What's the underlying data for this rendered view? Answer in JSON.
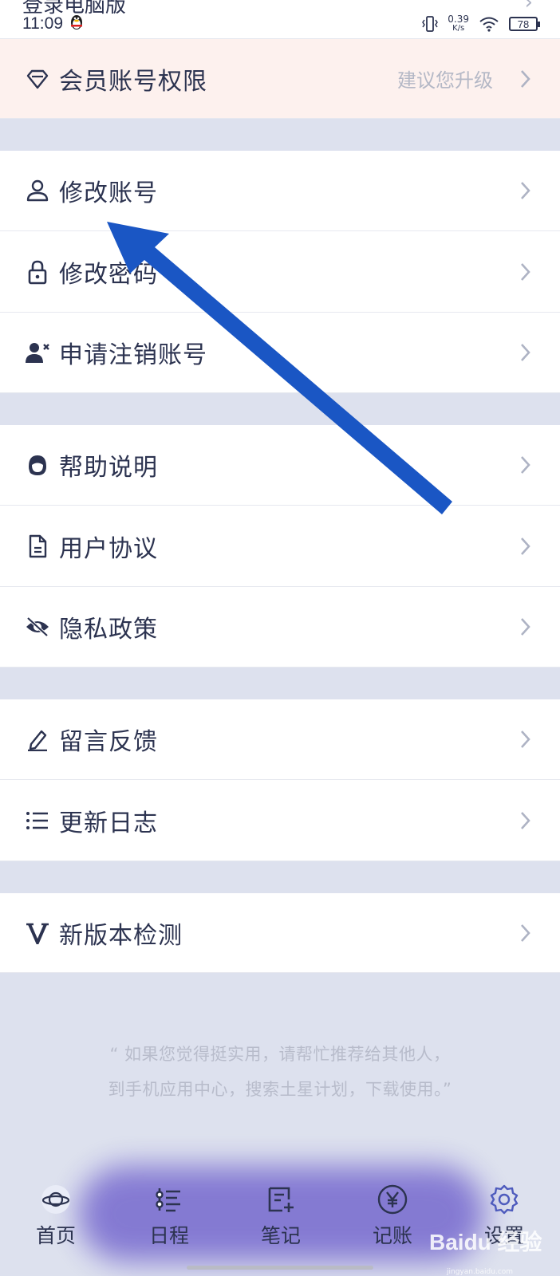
{
  "status_bar": {
    "cut_row_label": "登录电脑版",
    "time": "11:09",
    "net_speed_value": "0.39",
    "net_speed_unit": "K/s",
    "battery": "78"
  },
  "settings": {
    "member": {
      "label": "会员账号权限",
      "hint": "建议您升级",
      "icon": "diamond-icon"
    },
    "account_group": [
      {
        "label": "修改账号",
        "icon": "user-icon"
      },
      {
        "label": "修改密码",
        "icon": "lock-icon"
      },
      {
        "label": "申请注销账号",
        "icon": "user-remove-icon"
      }
    ],
    "info_group": [
      {
        "label": "帮助说明",
        "icon": "support-agent-icon"
      },
      {
        "label": "用户协议",
        "icon": "document-icon"
      },
      {
        "label": "隐私政策",
        "icon": "eye-off-icon"
      }
    ],
    "feedback_group": [
      {
        "label": "留言反馈",
        "icon": "pencil-icon"
      },
      {
        "label": "更新日志",
        "icon": "list-icon"
      }
    ],
    "version_group": [
      {
        "label": "新版本检测",
        "icon": "v-icon"
      }
    ]
  },
  "footer": {
    "line1": "“ 如果您觉得挺实用，请帮忙推荐给其他人，",
    "line2": "到手机应用中心，搜索土星计划，下载使用。”"
  },
  "tabbar": {
    "tabs": [
      {
        "label": "首页",
        "icon": "planet-icon"
      },
      {
        "label": "日程",
        "icon": "schedule-icon"
      },
      {
        "label": "笔记",
        "icon": "note-add-icon"
      },
      {
        "label": "记账",
        "icon": "yen-coin-icon"
      },
      {
        "label": "设置",
        "icon": "gear-icon"
      }
    ]
  },
  "watermark": {
    "text": "Baidu 经验",
    "sub": "jingyan.baidu.com"
  },
  "annotation_arrow_color": "#1a56c4",
  "accent_color": "#4e5bbd"
}
